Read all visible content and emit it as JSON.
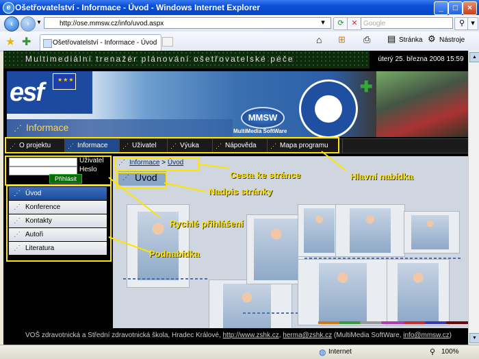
{
  "window": {
    "title": "Ošetřovatelství - Informace - Úvod - Windows Internet Explorer"
  },
  "browser": {
    "url": "http://ose.mmsw.cz/info/uvod.aspx",
    "search_placeholder": "Google",
    "tab_title": "Ošetřovatelství - Informace - Úvod",
    "page_menu": "Stránka",
    "tools_menu": "Nástroje",
    "status_zone": "Internet",
    "zoom": "100%"
  },
  "site": {
    "banner": "Multimediální trenažér plánování ošetřovatelské péče",
    "datetime": "úterý 25. března 2008 15:59",
    "esf": "esf",
    "section_title": "Informace",
    "mmsw": "MMSW",
    "mmsw_sub": "MultiMedia SoftWare",
    "main_menu": [
      "O projektu",
      "Informace",
      "Uživatel",
      "Výuka",
      "Nápověda",
      "Mapa programu"
    ],
    "login": {
      "user_label": "Uživatel",
      "password_label": "Heslo",
      "button": "Přihlásit"
    },
    "submenu": [
      "Úvod",
      "Konference",
      "Kontakty",
      "Autoři",
      "Literatura"
    ],
    "breadcrumb": {
      "root": "Informace",
      "sep": ">",
      "current": "Úvod"
    },
    "page_title": "Úvod",
    "footer": {
      "text1": "VOŠ zdravotnická a Střední zdravotnická škola, Hradec Králové,",
      "link1": "http://www.zshk.cz",
      "link2": "herma@zshk.cz",
      "text2": "(MultiMedia SoftWare,",
      "link3": "info@mmsw.cz",
      "text3": ")"
    }
  },
  "annotations": {
    "path": "Cesta ke stránce",
    "main_menu": "Hlavní nabídka",
    "page_title": "Nadpis stránky",
    "quick_login": "Rychlé přihlášení",
    "submenu": "Podnabídka"
  },
  "colors": {
    "accent": "#ffe400",
    "menu_active": "#1f4a8e",
    "titlebar": "#0a4fd6"
  }
}
